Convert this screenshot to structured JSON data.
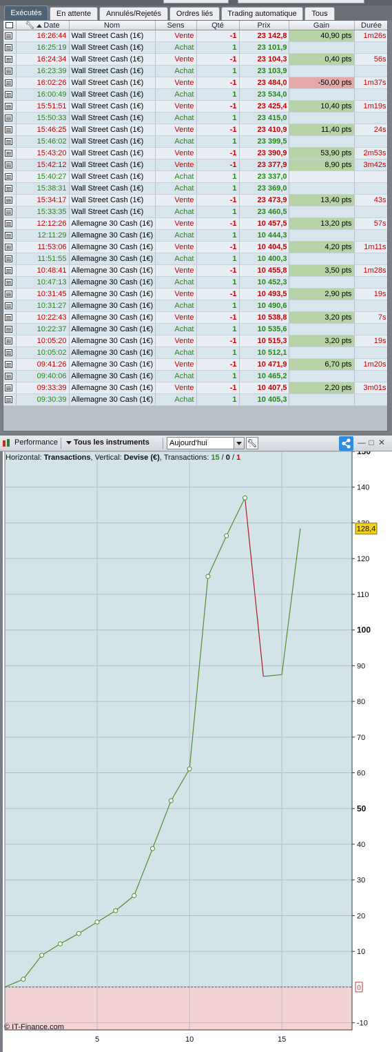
{
  "tabs": [
    {
      "label": "Exécutés",
      "active": true
    },
    {
      "label": "En attente",
      "active": false
    },
    {
      "label": "Annulés/Rejetés",
      "active": false
    },
    {
      "label": "Ordres liés",
      "active": false
    },
    {
      "label": "Trading automatique",
      "active": false
    },
    {
      "label": "Tous",
      "active": false
    }
  ],
  "table": {
    "columns": [
      "Date",
      "Nom",
      "Sens",
      "Qté",
      "Prix",
      "Gain",
      "Durée"
    ],
    "rows": [
      {
        "date": "16:26:44",
        "nom": "Wall Street Cash (1€)",
        "sens": "Vente",
        "qte": "-1",
        "prix": "23 142,8",
        "gain": "40,90 pts",
        "duree": "1m26s"
      },
      {
        "date": "16:25:19",
        "nom": "Wall Street Cash (1€)",
        "sens": "Achat",
        "qte": "1",
        "prix": "23 101,9",
        "gain": "",
        "duree": ""
      },
      {
        "date": "16:24:34",
        "nom": "Wall Street Cash (1€)",
        "sens": "Vente",
        "qte": "-1",
        "prix": "23 104,3",
        "gain": "0,40 pts",
        "duree": "56s"
      },
      {
        "date": "16:23:39",
        "nom": "Wall Street Cash (1€)",
        "sens": "Achat",
        "qte": "1",
        "prix": "23 103,9",
        "gain": "",
        "duree": ""
      },
      {
        "date": "16:02:26",
        "nom": "Wall Street Cash (1€)",
        "sens": "Vente",
        "qte": "-1",
        "prix": "23 484,0",
        "gain": "-50,00 pts",
        "duree": "1m37s"
      },
      {
        "date": "16:00:49",
        "nom": "Wall Street Cash (1€)",
        "sens": "Achat",
        "qte": "1",
        "prix": "23 534,0",
        "gain": "",
        "duree": ""
      },
      {
        "date": "15:51:51",
        "nom": "Wall Street Cash (1€)",
        "sens": "Vente",
        "qte": "-1",
        "prix": "23 425,4",
        "gain": "10,40 pts",
        "duree": "1m19s"
      },
      {
        "date": "15:50:33",
        "nom": "Wall Street Cash (1€)",
        "sens": "Achat",
        "qte": "1",
        "prix": "23 415,0",
        "gain": "",
        "duree": ""
      },
      {
        "date": "15:46:25",
        "nom": "Wall Street Cash (1€)",
        "sens": "Vente",
        "qte": "-1",
        "prix": "23 410,9",
        "gain": "11,40 pts",
        "duree": "24s"
      },
      {
        "date": "15:46:02",
        "nom": "Wall Street Cash (1€)",
        "sens": "Achat",
        "qte": "1",
        "prix": "23 399,5",
        "gain": "",
        "duree": ""
      },
      {
        "date": "15:43:20",
        "nom": "Wall Street Cash (1€)",
        "sens": "Vente",
        "qte": "-1",
        "prix": "23 390,9",
        "gain": "53,90 pts",
        "duree": "2m53s"
      },
      {
        "date": "15:42:12",
        "nom": "Wall Street Cash (1€)",
        "sens": "Vente",
        "qte": "-1",
        "prix": "23 377,9",
        "gain": "8,90 pts",
        "duree": "3m42s"
      },
      {
        "date": "15:40:27",
        "nom": "Wall Street Cash (1€)",
        "sens": "Achat",
        "qte": "1",
        "prix": "23 337,0",
        "gain": "",
        "duree": ""
      },
      {
        "date": "15:38:31",
        "nom": "Wall Street Cash (1€)",
        "sens": "Achat",
        "qte": "1",
        "prix": "23 369,0",
        "gain": "",
        "duree": ""
      },
      {
        "date": "15:34:17",
        "nom": "Wall Street Cash (1€)",
        "sens": "Vente",
        "qte": "-1",
        "prix": "23 473,9",
        "gain": "13,40 pts",
        "duree": "43s"
      },
      {
        "date": "15:33:35",
        "nom": "Wall Street Cash (1€)",
        "sens": "Achat",
        "qte": "1",
        "prix": "23 460,5",
        "gain": "",
        "duree": ""
      },
      {
        "date": "12:12:26",
        "nom": "Allemagne 30 Cash (1€)",
        "sens": "Vente",
        "qte": "-1",
        "prix": "10 457,5",
        "gain": "13,20 pts",
        "duree": "57s"
      },
      {
        "date": "12:11:29",
        "nom": "Allemagne 30 Cash (1€)",
        "sens": "Achat",
        "qte": "1",
        "prix": "10 444,3",
        "gain": "",
        "duree": ""
      },
      {
        "date": "11:53:06",
        "nom": "Allemagne 30 Cash (1€)",
        "sens": "Vente",
        "qte": "-1",
        "prix": "10 404,5",
        "gain": "4,20 pts",
        "duree": "1m11s"
      },
      {
        "date": "11:51:55",
        "nom": "Allemagne 30 Cash (1€)",
        "sens": "Achat",
        "qte": "1",
        "prix": "10 400,3",
        "gain": "",
        "duree": ""
      },
      {
        "date": "10:48:41",
        "nom": "Allemagne 30 Cash (1€)",
        "sens": "Vente",
        "qte": "-1",
        "prix": "10 455,8",
        "gain": "3,50 pts",
        "duree": "1m28s"
      },
      {
        "date": "10:47:13",
        "nom": "Allemagne 30 Cash (1€)",
        "sens": "Achat",
        "qte": "1",
        "prix": "10 452,3",
        "gain": "",
        "duree": ""
      },
      {
        "date": "10:31:45",
        "nom": "Allemagne 30 Cash (1€)",
        "sens": "Vente",
        "qte": "-1",
        "prix": "10 493,5",
        "gain": "2,90 pts",
        "duree": "19s"
      },
      {
        "date": "10:31:27",
        "nom": "Allemagne 30 Cash (1€)",
        "sens": "Achat",
        "qte": "1",
        "prix": "10 490,6",
        "gain": "",
        "duree": ""
      },
      {
        "date": "10:22:43",
        "nom": "Allemagne 30 Cash (1€)",
        "sens": "Vente",
        "qte": "-1",
        "prix": "10 538,8",
        "gain": "3,20 pts",
        "duree": "7s"
      },
      {
        "date": "10:22:37",
        "nom": "Allemagne 30 Cash (1€)",
        "sens": "Achat",
        "qte": "1",
        "prix": "10 535,6",
        "gain": "",
        "duree": ""
      },
      {
        "date": "10:05:20",
        "nom": "Allemagne 30 Cash (1€)",
        "sens": "Vente",
        "qte": "-1",
        "prix": "10 515,3",
        "gain": "3,20 pts",
        "duree": "19s"
      },
      {
        "date": "10:05:02",
        "nom": "Allemagne 30 Cash (1€)",
        "sens": "Achat",
        "qte": "1",
        "prix": "10 512,1",
        "gain": "",
        "duree": ""
      },
      {
        "date": "09:41:26",
        "nom": "Allemagne 30 Cash (1€)",
        "sens": "Vente",
        "qte": "-1",
        "prix": "10 471,9",
        "gain": "6,70 pts",
        "duree": "1m20s"
      },
      {
        "date": "09:40:06",
        "nom": "Allemagne 30 Cash (1€)",
        "sens": "Achat",
        "qte": "1",
        "prix": "10 465,2",
        "gain": "",
        "duree": ""
      },
      {
        "date": "09:33:39",
        "nom": "Allemagne 30 Cash (1€)",
        "sens": "Vente",
        "qte": "-1",
        "prix": "10 407,5",
        "gain": "2,20 pts",
        "duree": "3m01s"
      },
      {
        "date": "09:30:39",
        "nom": "Allemagne 30 Cash (1€)",
        "sens": "Achat",
        "qte": "1",
        "prix": "10 405,3",
        "gain": "",
        "duree": ""
      }
    ]
  },
  "perf_toolbar": {
    "performance_label": "Performance",
    "instruments_label": "Tous les instruments",
    "period_value": "Aujourd'hui"
  },
  "chart_info": {
    "horizontal_prefix": "Horizontal: ",
    "horizontal_value": "Transactions",
    "vertical_prefix": ", Vertical: ",
    "vertical_value": "Devise (€)",
    "transactions_prefix": ", Transactions: ",
    "tx_win": "15",
    "tx_sep1": " / ",
    "tx_neutral": "0",
    "tx_sep2": " / ",
    "tx_loss": "1",
    "watermark": "© IT-Finance.com",
    "last_value_label": "128,4",
    "zero_label": "0"
  },
  "colors": {
    "sell": "#c40000",
    "buy": "#238a0e",
    "gain_pos_bg": "#b6d4a5",
    "gain_neg_bg": "#e5a9a9",
    "chart_bg": "#d3e4e8",
    "chart_neg_bg": "#f3d3d3",
    "line_up": "#4e8f2f",
    "line_down": "#b0182a"
  },
  "chart_data": {
    "type": "line",
    "x": [
      0,
      1,
      2,
      3,
      4,
      5,
      6,
      7,
      8,
      9,
      10,
      11,
      12,
      13,
      14,
      15,
      16
    ],
    "series": [
      {
        "values": [
          0,
          2.2,
          8.9,
          12.1,
          15.0,
          18.2,
          21.4,
          25.6,
          38.8,
          52.2,
          61.1,
          115.0,
          126.4,
          137.0,
          87.0,
          87.5,
          128.4
        ]
      }
    ],
    "markers_through_index": 13,
    "xticks": [
      5,
      10,
      15
    ],
    "yticks": [
      -10,
      0,
      10,
      20,
      30,
      40,
      50,
      60,
      70,
      80,
      90,
      100,
      110,
      120,
      130,
      140,
      150
    ],
    "ylim": [
      -12,
      150
    ],
    "xlim": [
      0,
      18.8
    ],
    "grid": true
  }
}
